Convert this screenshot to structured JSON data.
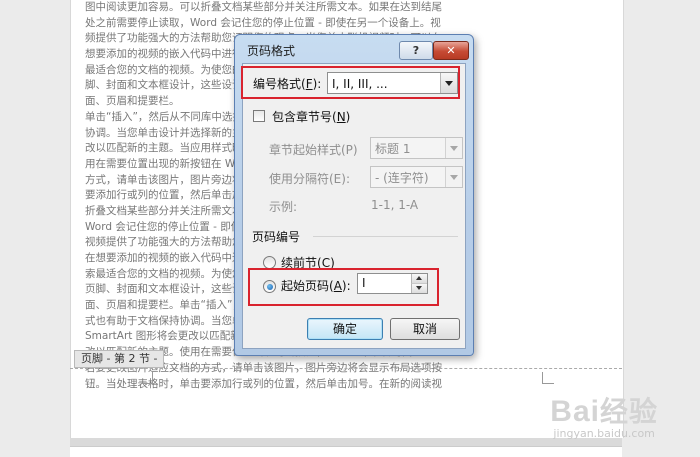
{
  "document": {
    "lines": [
      "图中阅读更加容易。可以折叠文档某些部分并关注所需文本。如果在达到结尾",
      "处之前需要停止读取，Word 会记住您的停止位置 - 即使在另一个设备上。视",
      "频提供了功能强大的方法帮助您证明您的观点。当您单击联机视频时，可以在",
      "想要添加的视频的嵌入代码中进行粘贴。您也可以键入一个关键字以联机搜索",
      "最适合您的文档的视频。为使您的文档具有专业外观，Word 提供了页眉、页",
      "脚、封面和文本框设计，这些设计可互为补充。例如，您可以添加匹配的封",
      "面、页眉和提要栏。",
      "单击“插入”，然后从不同库中选择所需元素。主题和样式也有助于文档保持",
      "协调。当您单击设计并选择新的主题时，图片、图表或 SmartArt 图形将会更",
      "改以匹配新的主题。当应用样式时，您的标题会进行更改以匹配新的主题。使",
      "用在需要位置出现的新按钮在 Word 中节省时间。若要更改图片适应文档的",
      "方式，请单击该图片，图片旁边将会显示布局选项按钮。当处理表格时，单击",
      "要添加行或列的位置，然后单击加号。在新的阅读视图中阅读更加容易。可以",
      "折叠文档某些部分并关注所需文本。如果在达到结尾处之前需要停止读取，",
      "Word 会记住您的停止位置 - 即使在另一个设备上。",
      "视频提供了功能强大的方法帮助您证明您的观点。当您单击联机视频时，可以",
      "在想要添加的视频的嵌入代码中进行粘贴。您也可以键入一个关键字以联机搜",
      "索最适合您的文档的视频。为使您的文档具有专业外观，Word 提供了页眉、",
      "页脚、封面和文本框设计，这些设计可互为补充。例如，您可以添加匹配的封",
      "面、页眉和提要栏。单击“插入”，然后从不同库中选择所需元素。主题和样",
      "式也有助于文档保持协调。当您单击设计并选择新的主题时，图片、图表或",
      "SmartArt 图形将会更改以匹配新的主题。当应用样式时，您的标题会进行更",
      "改以匹配新的主题。使用在需要位置出现的新按钮在 Word 中节省时间。",
      "若要更改图片适应文档的方式，请单击该图片，图片旁边将会显示布局选项按",
      "钮。当处理表格时，单击要添加行或列的位置，然后单击加号。在新的阅读视"
    ],
    "footer_tag": "页脚 - 第 2 节 -"
  },
  "dialog": {
    "title": "页码格式",
    "help_label": "?",
    "close_label": "✕",
    "number_format": {
      "label": "编号格式(",
      "key": "F",
      "label_end": "):",
      "value": "I, II, III, ..."
    },
    "include_chapter": {
      "label": "包含章节号(",
      "key": "N",
      "label_end": ")"
    },
    "chapter_style": {
      "label": "章节起始样式(P)",
      "value": "标题 1"
    },
    "separator": {
      "label": "使用分隔符(E):",
      "value": "-   (连字符)"
    },
    "example": {
      "label": "示例:",
      "value": "1-1, 1-A"
    },
    "page_numbering": {
      "section_label": "页码编号",
      "continue": {
        "label": "续前节(",
        "key": "C",
        "label_end": ")"
      },
      "start_at": {
        "label": "起始页码(",
        "key": "A",
        "label_end": "):",
        "value": "I"
      }
    },
    "ok_label": "确定",
    "cancel_label": "取消"
  },
  "watermark": {
    "logo_left": "Bai",
    "logo_right": "经验",
    "url": "jingyan.baidu.com"
  },
  "colors": {
    "highlight": "#d9232e",
    "title_bar": "#c7dcf1",
    "close_button": "#c64b34"
  }
}
